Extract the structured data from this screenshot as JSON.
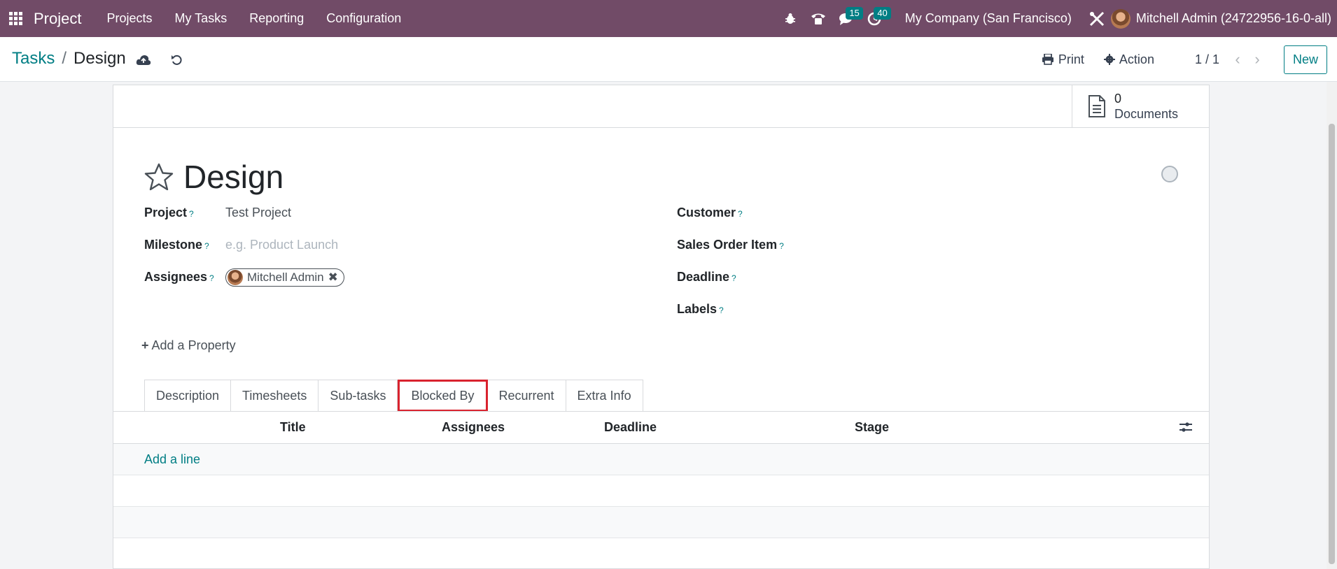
{
  "navbar": {
    "app_name": "Project",
    "menu": [
      "Projects",
      "My Tasks",
      "Reporting",
      "Configuration"
    ],
    "messages_badge": "15",
    "activities_badge": "40",
    "company": "My Company (San Francisco)",
    "user": "Mitchell Admin (24722956-16-0-all)",
    "brand_color": "#714b67"
  },
  "control_panel": {
    "breadcrumb_parent": "Tasks",
    "breadcrumb_sep": "/",
    "breadcrumb_current": "Design",
    "print_label": "Print",
    "action_label": "Action",
    "pager": "1 / 1",
    "new_label": "New"
  },
  "smart_button": {
    "count": "0",
    "label": "Documents"
  },
  "form": {
    "title": "Design",
    "project_label": "Project",
    "project_value": "Test Project",
    "milestone_label": "Milestone",
    "milestone_placeholder": "e.g. Product Launch",
    "assignees_label": "Assignees",
    "assignee_tag": "Mitchell Admin",
    "customer_label": "Customer",
    "sales_order_label": "Sales Order Item",
    "deadline_label": "Deadline",
    "labels_label": "Labels",
    "help_mark": "?",
    "add_property": "Add a Property"
  },
  "tabs": [
    "Description",
    "Timesheets",
    "Sub-tasks",
    "Blocked By",
    "Recurrent",
    "Extra Info"
  ],
  "active_tab": "Blocked By",
  "list": {
    "columns": [
      "Title",
      "Assignees",
      "Deadline",
      "Stage"
    ],
    "add_line": "Add a line"
  }
}
